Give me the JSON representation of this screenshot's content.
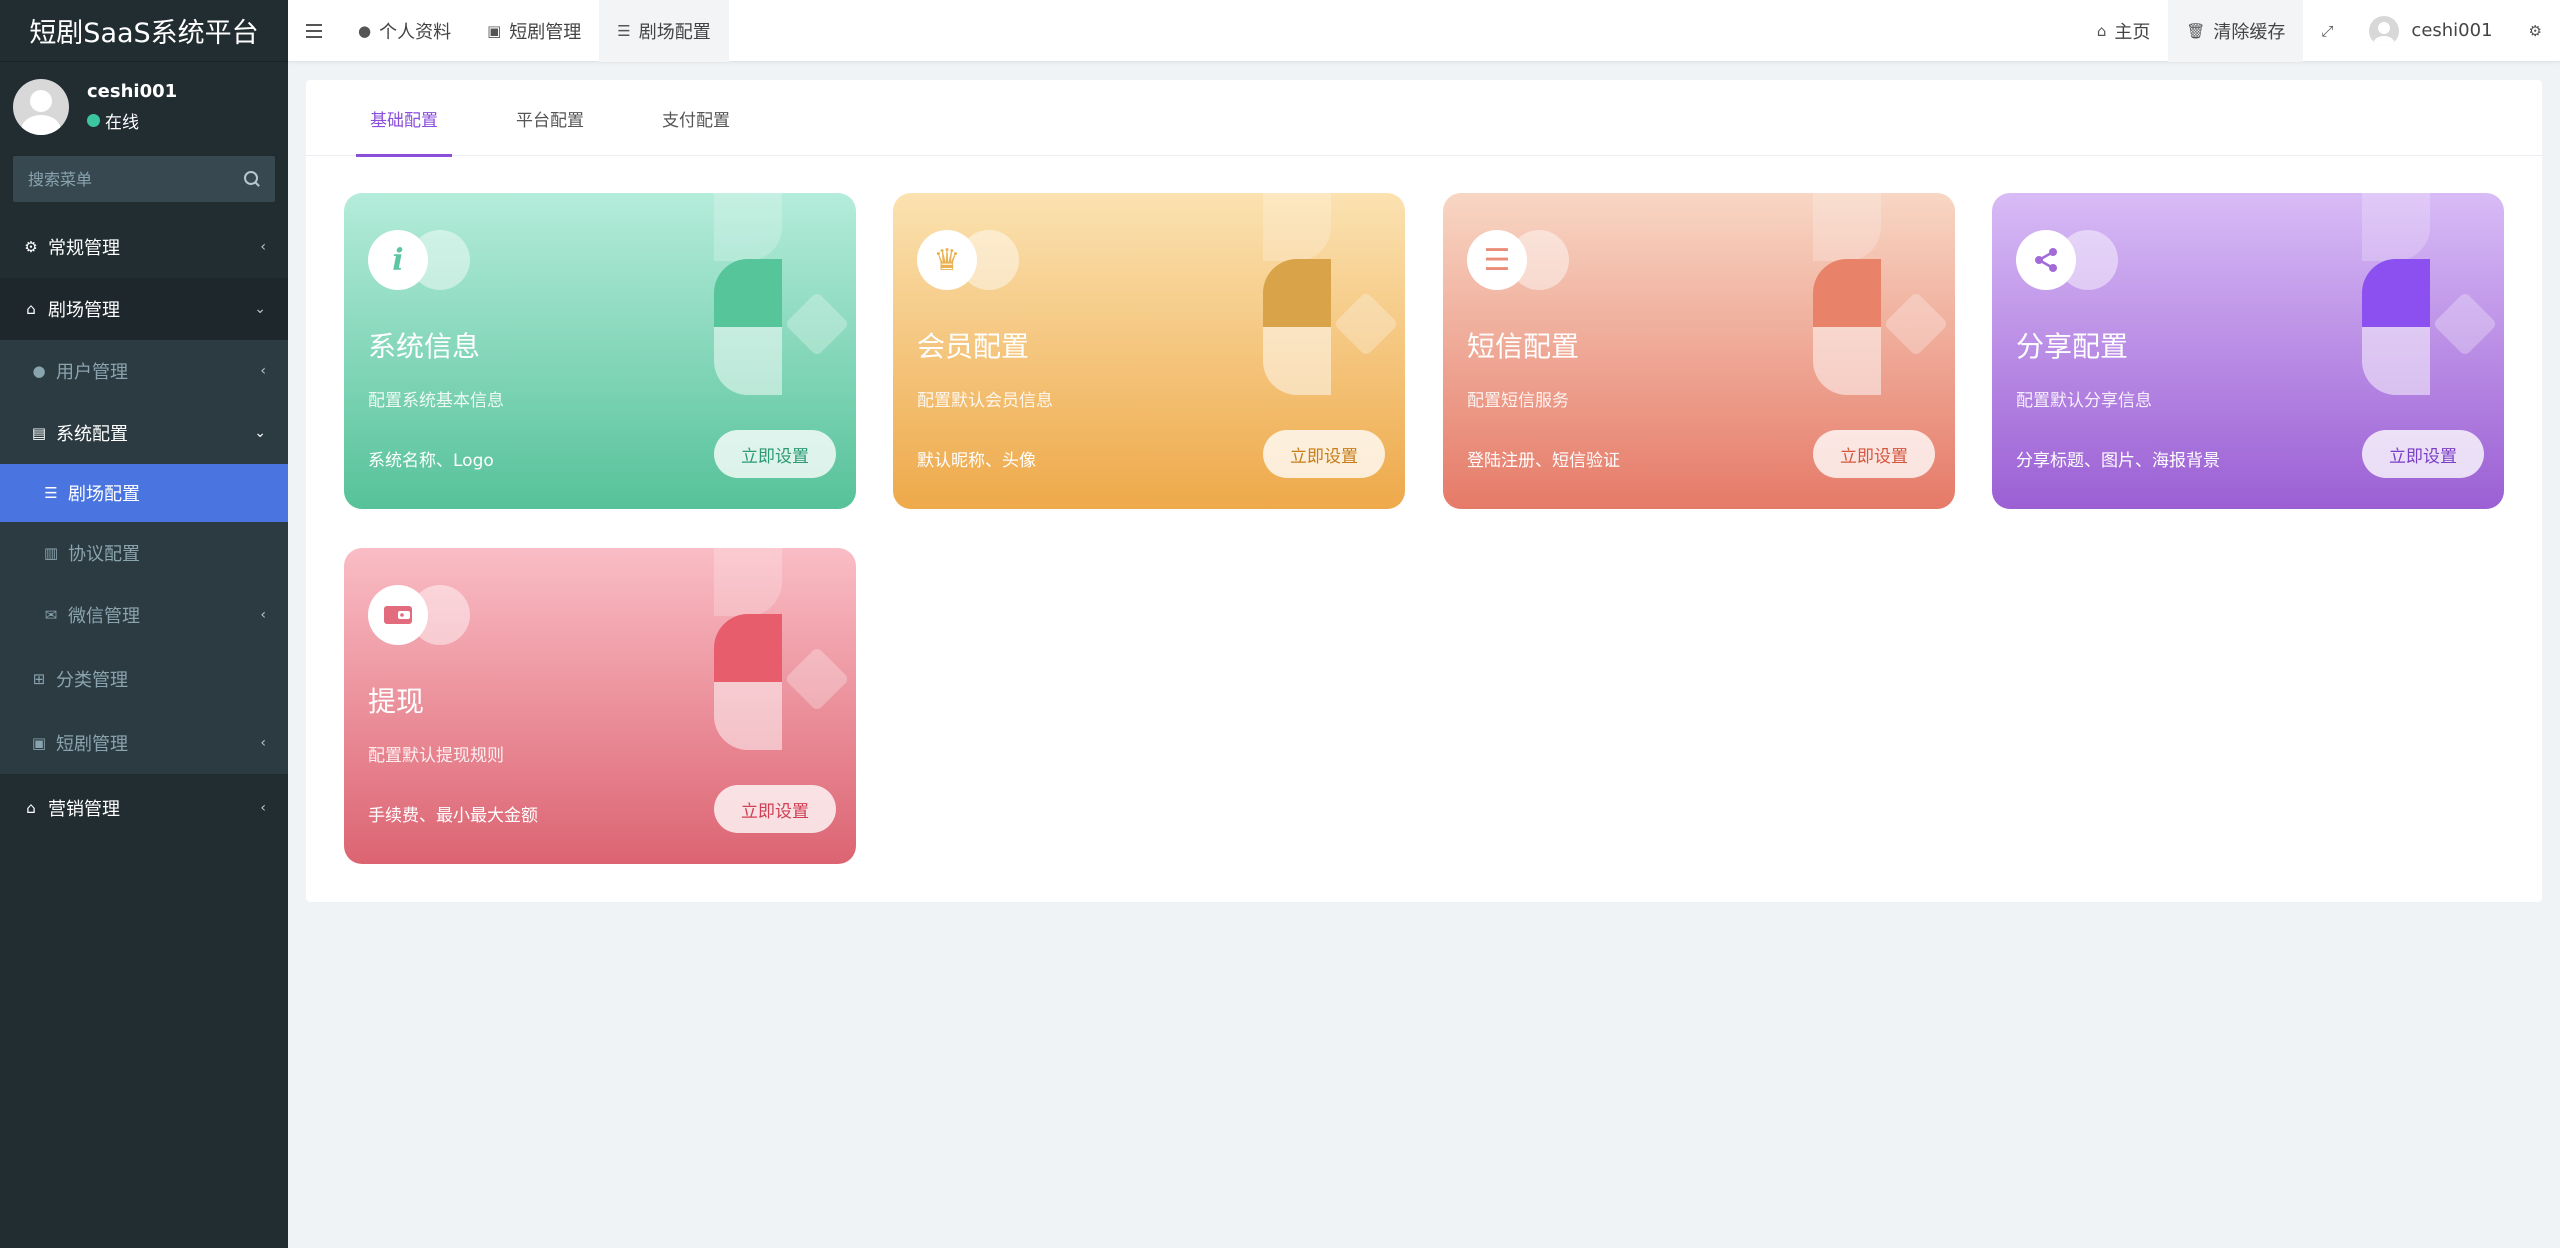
{
  "app": {
    "title": "短剧SaaS系统平台"
  },
  "user": {
    "name": "ceshi001",
    "status": "在线"
  },
  "search": {
    "placeholder": "搜索菜单"
  },
  "sidebar": {
    "items": [
      {
        "label": "常规管理"
      },
      {
        "label": "剧场管理"
      },
      {
        "label": "用户管理"
      },
      {
        "label": "系统配置"
      },
      {
        "label": "剧场配置"
      },
      {
        "label": "协议配置"
      },
      {
        "label": "微信管理"
      },
      {
        "label": "分类管理"
      },
      {
        "label": "短剧管理"
      },
      {
        "label": "营销管理"
      }
    ]
  },
  "topbar": {
    "tabs": [
      {
        "label": "个人资料"
      },
      {
        "label": "短剧管理"
      },
      {
        "label": "剧场配置"
      }
    ],
    "home": "主页",
    "clear_cache": "清除缓存",
    "username": "ceshi001"
  },
  "content": {
    "tabs": [
      {
        "label": "基础配置"
      },
      {
        "label": "平台配置"
      },
      {
        "label": "支付配置"
      }
    ],
    "cards": [
      {
        "title": "系统信息",
        "desc": "配置系统基本信息",
        "detail": "系统名称、Logo",
        "button": "立即设置",
        "icon": "info-icon"
      },
      {
        "title": "会员配置",
        "desc": "配置默认会员信息",
        "detail": "默认昵称、头像",
        "button": "立即设置",
        "icon": "crown-icon"
      },
      {
        "title": "短信配置",
        "desc": "配置短信服务",
        "detail": "登陆注册、短信验证",
        "button": "立即设置",
        "icon": "database-icon"
      },
      {
        "title": "分享配置",
        "desc": "配置默认分享信息",
        "detail": "分享标题、图片、海报背景",
        "button": "立即设置",
        "icon": "share-icon"
      },
      {
        "title": "提现",
        "desc": "配置默认提现规则",
        "detail": "手续费、最小最大金额",
        "button": "立即设置",
        "icon": "wallet-icon"
      }
    ]
  },
  "colors": {
    "active_menu": "#4a75e0",
    "active_tab": "#8a4fdb",
    "sidebar_bg": "#222d32"
  }
}
